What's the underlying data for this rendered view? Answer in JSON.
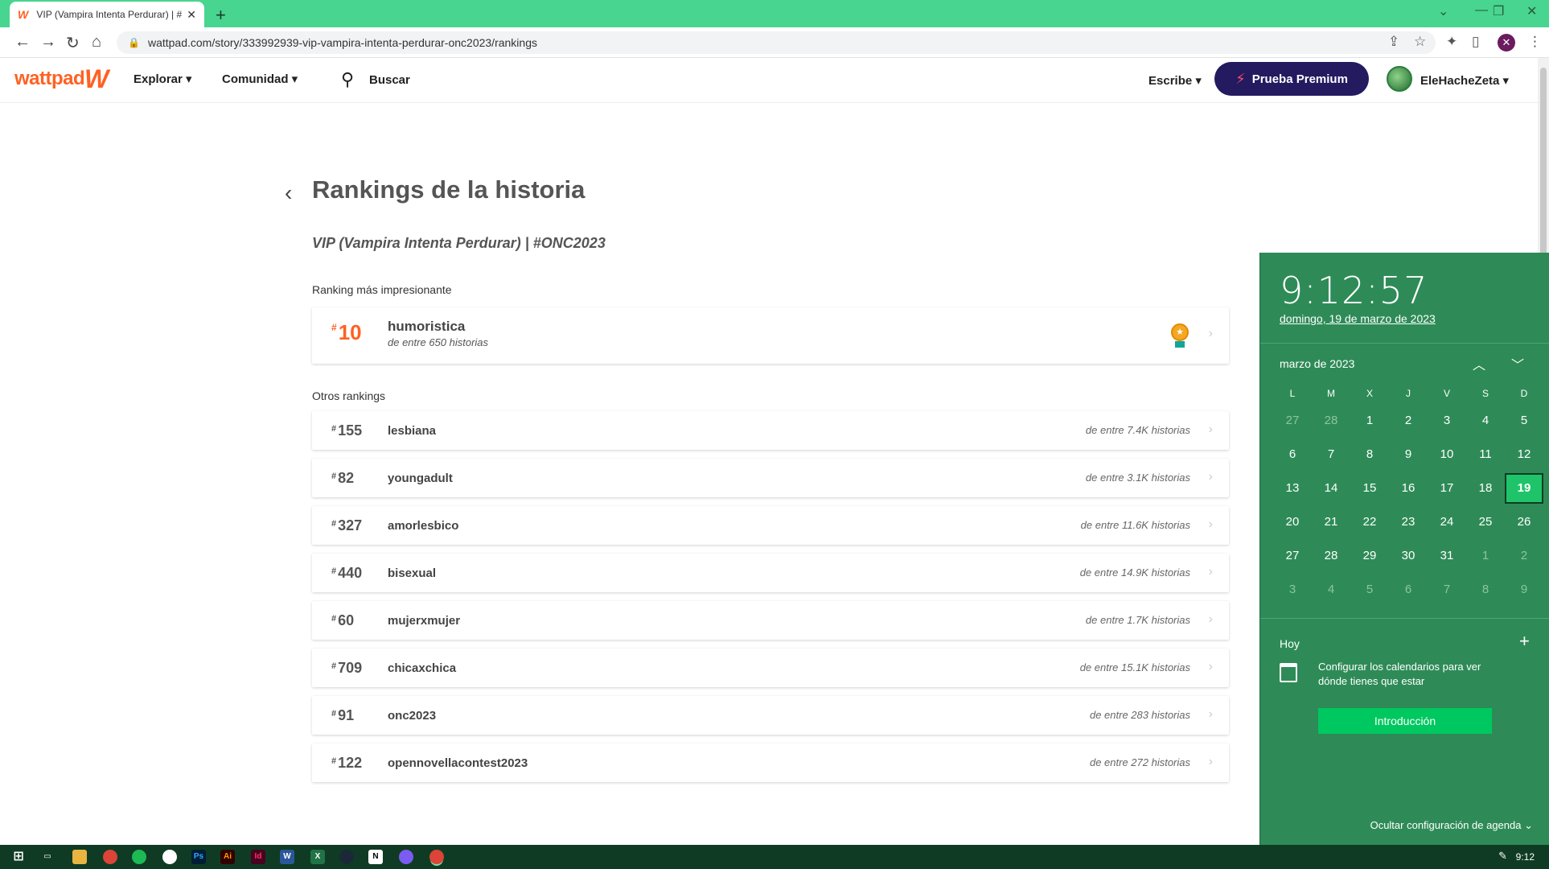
{
  "browser": {
    "tab_title": "VIP (Vampira Intenta Perdurar) | #",
    "tab_close": "✕",
    "new_tab": "+",
    "url": "wattpad.com/story/333992939-vip-vampira-intenta-perdurar-onc2023/rankings"
  },
  "header": {
    "logo": "wattpad",
    "nav": {
      "explore": "Explorar ▾",
      "community": "Comunidad ▾",
      "search": "Buscar"
    },
    "write": "Escribe ▾",
    "premium": "Prueba Premium",
    "username": "EleHacheZeta ▾"
  },
  "page": {
    "title": "Rankings de la historia",
    "story_title": "VIP (Vampira Intenta Perdurar) | #ONC2023",
    "best_label": "Ranking más impresionante",
    "others_label": "Otros rankings"
  },
  "best_ranking": {
    "rank": "10",
    "tag": "humoristica",
    "count": "de entre 650 historias"
  },
  "rankings": [
    {
      "rank": "155",
      "tag": "lesbiana",
      "count": "de entre 7.4K historias"
    },
    {
      "rank": "82",
      "tag": "youngadult",
      "count": "de entre 3.1K historias"
    },
    {
      "rank": "327",
      "tag": "amorlesbico",
      "count": "de entre 11.6K historias"
    },
    {
      "rank": "440",
      "tag": "bisexual",
      "count": "de entre 14.9K historias"
    },
    {
      "rank": "60",
      "tag": "mujerxmujer",
      "count": "de entre 1.7K historias"
    },
    {
      "rank": "709",
      "tag": "chicaxchica",
      "count": "de entre 15.1K historias"
    },
    {
      "rank": "91",
      "tag": "onc2023",
      "count": "de entre 283 historias"
    },
    {
      "rank": "122",
      "tag": "opennovellacontest2023",
      "count": "de entre 272 historias"
    }
  ],
  "calendar": {
    "time": "9:12:57",
    "date": "domingo, 19 de marzo de 2023",
    "month": "marzo de 2023",
    "weekdays": [
      "L",
      "M",
      "X",
      "J",
      "V",
      "S",
      "D"
    ],
    "weeks": [
      [
        "27",
        "28",
        "1",
        "2",
        "3",
        "4",
        "5"
      ],
      [
        "6",
        "7",
        "8",
        "9",
        "10",
        "11",
        "12"
      ],
      [
        "13",
        "14",
        "15",
        "16",
        "17",
        "18",
        "19"
      ],
      [
        "20",
        "21",
        "22",
        "23",
        "24",
        "25",
        "26"
      ],
      [
        "27",
        "28",
        "29",
        "30",
        "31",
        "1",
        "2"
      ],
      [
        "3",
        "4",
        "5",
        "6",
        "7",
        "8",
        "9"
      ]
    ],
    "today": "19",
    "today_label": "Hoy",
    "info": "Configurar los calendarios para ver dónde tienes que estar",
    "button": "Introducción",
    "hide": "Ocultar configuración de agenda ⌄"
  },
  "taskbar": {
    "time": "9:12",
    "apps": [
      "Ps",
      "Ai",
      "Id",
      "W",
      "X"
    ]
  }
}
